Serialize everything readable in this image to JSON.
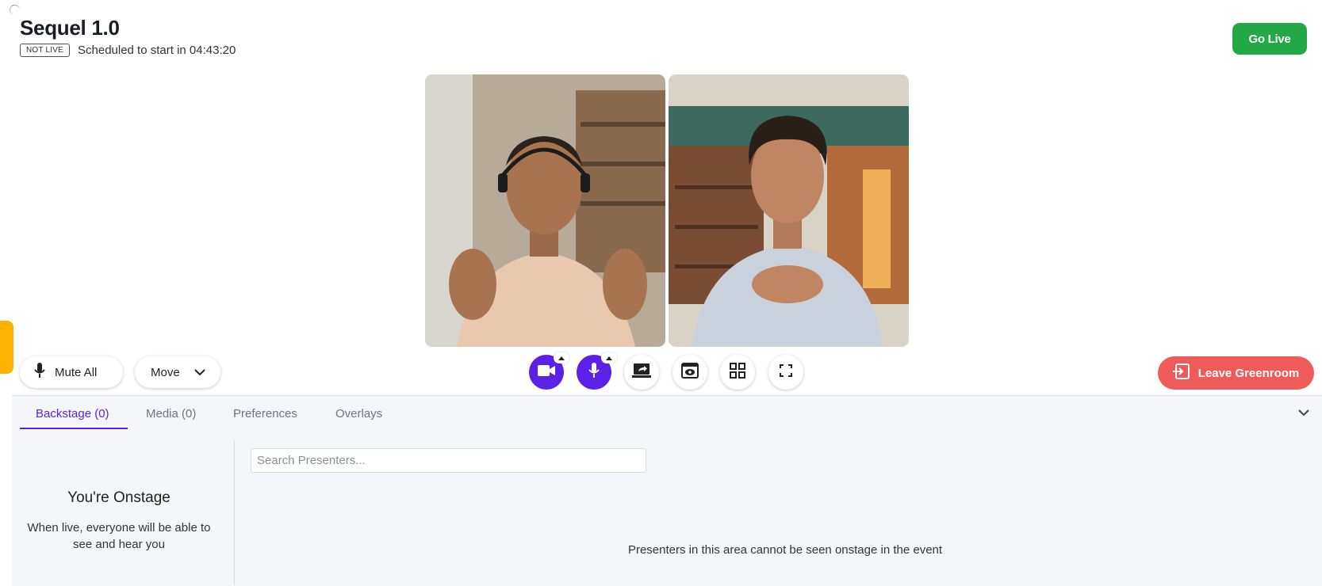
{
  "header": {
    "title": "Sequel 1.0",
    "status_badge": "NOT LIVE",
    "schedule_text": "Scheduled to start in 04:43:20",
    "go_live_label": "Go Live"
  },
  "stage": {
    "presenters": [
      {
        "name": "presenter-1"
      },
      {
        "name": "presenter-2"
      }
    ]
  },
  "controls": {
    "mute_all_label": "Mute All",
    "move_label": "Move",
    "leave_label": "Leave Greenroom",
    "icons": [
      "camera-icon",
      "microphone-icon",
      "share-screen-icon",
      "preview-icon",
      "layout-grid-icon",
      "fullscreen-icon"
    ]
  },
  "tabs": [
    {
      "label": "Backstage (0)",
      "active": true
    },
    {
      "label": "Media (0)",
      "active": false
    },
    {
      "label": "Preferences",
      "active": false
    },
    {
      "label": "Overlays",
      "active": false
    }
  ],
  "backstage": {
    "onstage_title": "You're Onstage",
    "onstage_desc": "When live, everyone will be able to see and hear you",
    "search_placeholder": "Search Presenters...",
    "empty_message": "Presenters in this area cannot be seen onstage in the event"
  },
  "colors": {
    "accent": "#5b21e6",
    "go_live": "#22a844",
    "leave": "#ef5a5a",
    "side_tab": "#ffb100"
  }
}
